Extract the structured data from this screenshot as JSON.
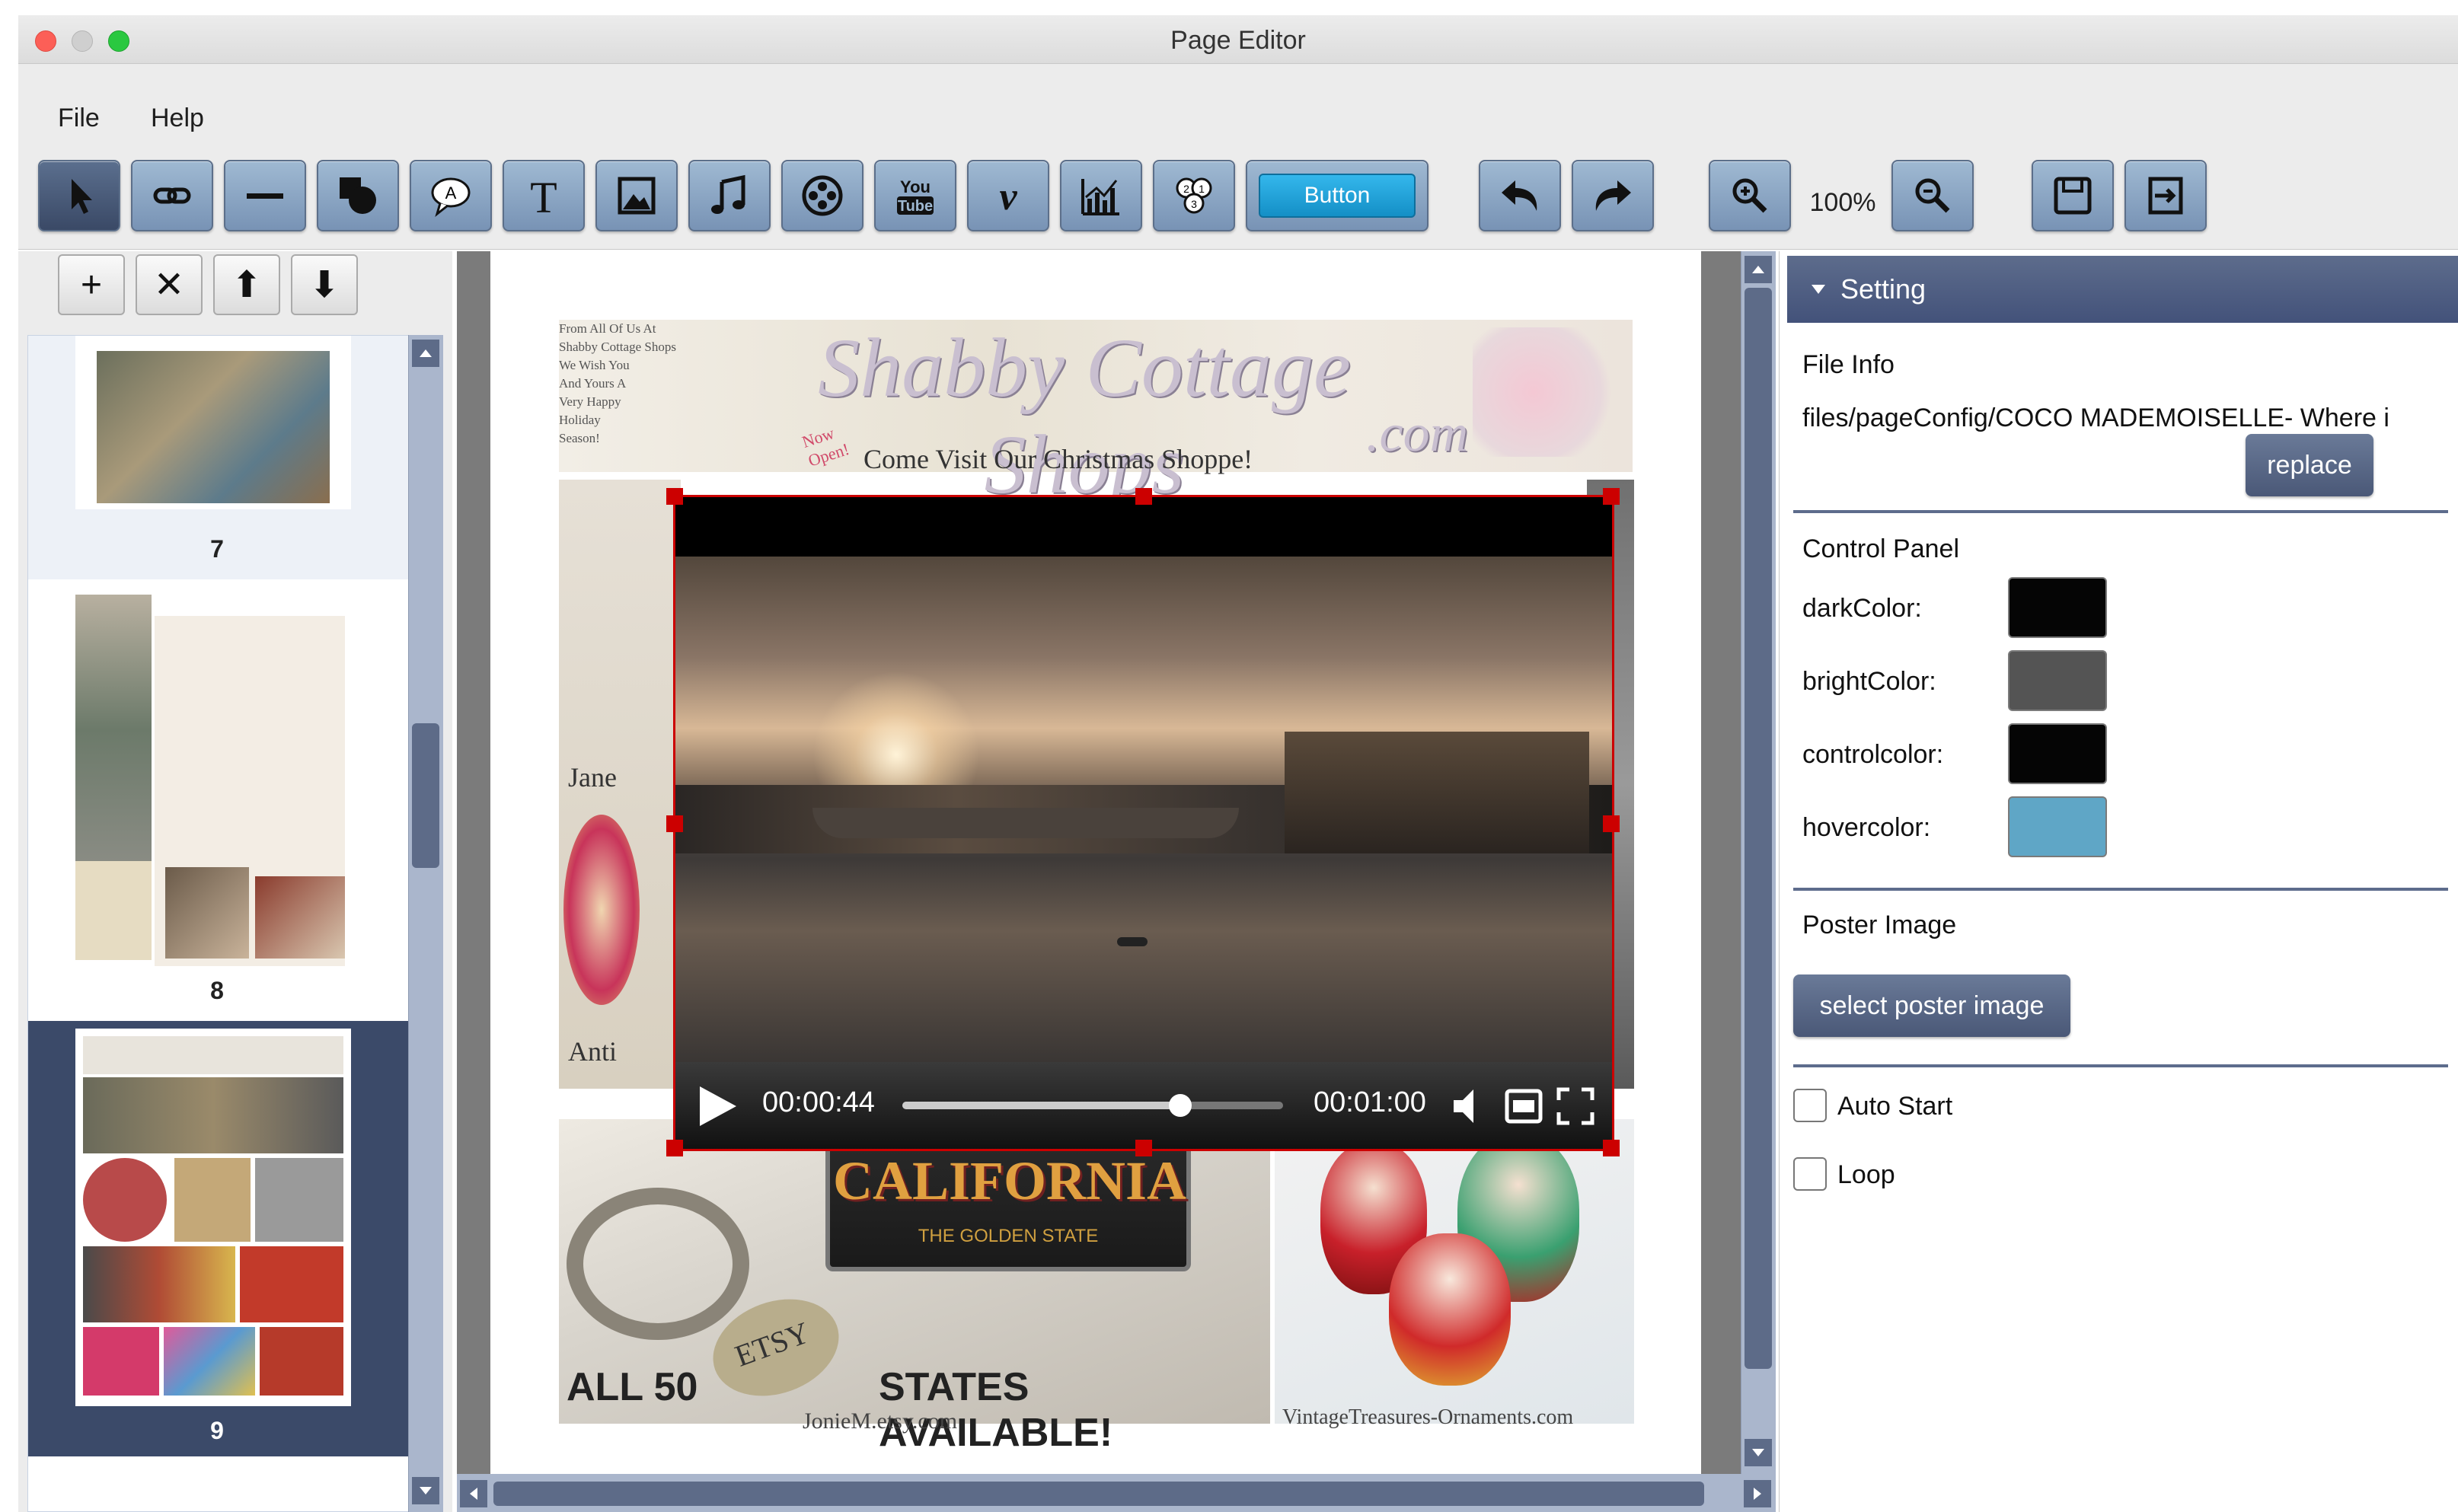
{
  "window": {
    "title": "Page Editor"
  },
  "menu": {
    "items": [
      "File",
      "Help"
    ]
  },
  "toolbar": {
    "button_tool_label": "Button",
    "zoom_level": "100%",
    "tools": [
      "select-arrow-icon",
      "link-icon",
      "line-icon",
      "shape-icon",
      "callout-icon",
      "text-icon",
      "image-icon",
      "music-note-icon",
      "film-reel-icon",
      "youtube-icon",
      "vimeo-icon",
      "chart-icon",
      "numbered-list-icon",
      "button-tool",
      "undo-icon",
      "redo-icon",
      "zoom-in-icon",
      "zoom-out-icon",
      "save-icon",
      "exit-icon"
    ]
  },
  "page_list": {
    "actions": [
      "+",
      "✕",
      "⬆",
      "⬇"
    ],
    "pages": [
      {
        "number": "7",
        "selected": false
      },
      {
        "number": "8",
        "selected": false
      },
      {
        "number": "9",
        "selected": true
      }
    ]
  },
  "canvas": {
    "header_left_text": "From All Of Us At\nShabby Cottage Shops\nWe Wish You\nAnd Yours A\nVery Happy\nHoliday\nSeason!",
    "banner_script": "Shabby Cottage Shops",
    "banner_com": ".com",
    "banner_sub": "Come Visit Our Christmas Shoppe!",
    "now_open": "Now\nOpen!",
    "left_label_top": "Jane",
    "left_label_bottom": "Anti",
    "ca_text": "CALIFORNIA",
    "ca_sub": "THE GOLDEN STATE",
    "states_text_a": "ALL 50",
    "states_text_b": "STATES AVAILABLE!",
    "etsy_tag": "ETSY",
    "caption_left": "JonieM.etsy.com",
    "caption_right": "VintageTreasures-Ornaments.com"
  },
  "video": {
    "current_time": "00:00:44",
    "duration": "00:01:00",
    "progress": 0.73
  },
  "settings": {
    "header": "Setting",
    "file_info_label": "File Info",
    "file_path": "files/pageConfig/COCO MADEMOISELLE- Where i",
    "replace_label": "replace",
    "control_panel_label": "Control Panel",
    "colors": [
      {
        "label": "darkColor:",
        "value": "#050505"
      },
      {
        "label": "brightColor:",
        "value": "#545454"
      },
      {
        "label": "controlcolor:",
        "value": "#050505"
      },
      {
        "label": "hovercolor:",
        "value": "#5fa6c6"
      }
    ],
    "poster_label": "Poster Image",
    "select_poster_label": "select poster image",
    "auto_start_label": "Auto Start",
    "loop_label": "Loop"
  }
}
